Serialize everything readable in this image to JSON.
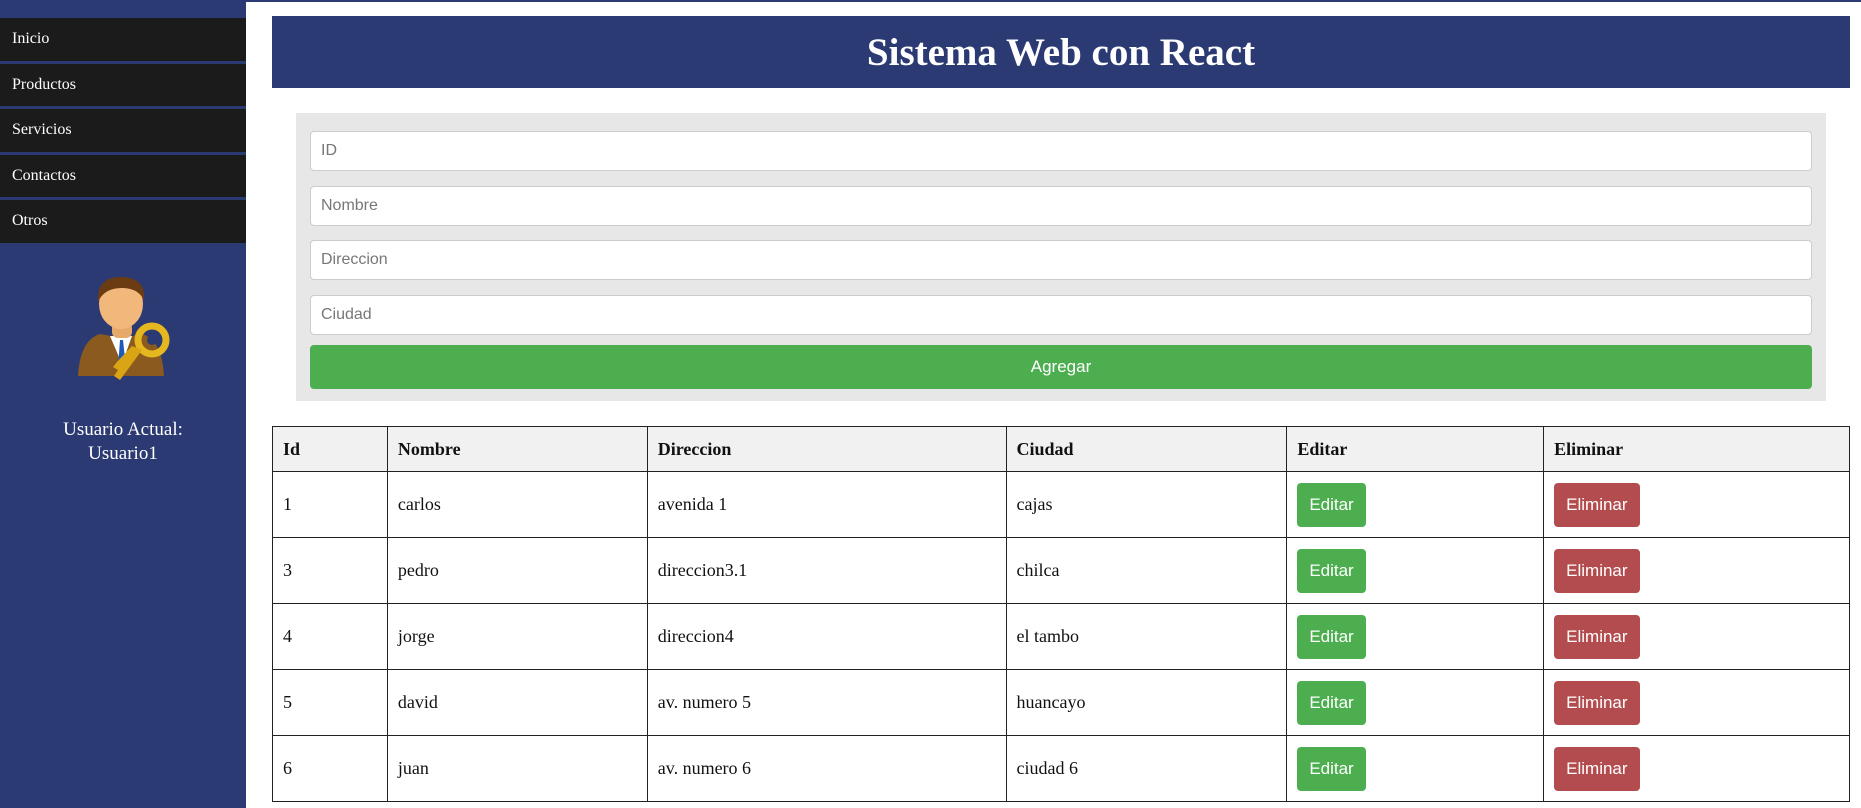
{
  "sidebar": {
    "items": [
      {
        "label": "Inicio"
      },
      {
        "label": "Productos"
      },
      {
        "label": "Servicios"
      },
      {
        "label": "Contactos"
      },
      {
        "label": "Otros"
      }
    ],
    "user_line1": "Usuario Actual:",
    "user_line2": "Usuario1",
    "avatar_icon": "user-key-icon"
  },
  "header": {
    "title": "Sistema Web con React"
  },
  "form": {
    "id_placeholder": "ID",
    "nombre_placeholder": "Nombre",
    "direccion_placeholder": "Direccion",
    "ciudad_placeholder": "Ciudad",
    "add_label": "Agregar"
  },
  "table": {
    "headers": [
      "Id",
      "Nombre",
      "Direccion",
      "Ciudad",
      "Editar",
      "Eliminar"
    ],
    "edit_label": "Editar",
    "delete_label": "Eliminar",
    "rows": [
      {
        "id": "1",
        "nombre": "carlos",
        "direccion": "avenida 1",
        "ciudad": "cajas"
      },
      {
        "id": "3",
        "nombre": "pedro",
        "direccion": "direccion3.1",
        "ciudad": "chilca"
      },
      {
        "id": "4",
        "nombre": "jorge",
        "direccion": "direccion4",
        "ciudad": "el tambo"
      },
      {
        "id": "5",
        "nombre": "david",
        "direccion": "av. numero 5",
        "ciudad": "huancayo"
      },
      {
        "id": "6",
        "nombre": "juan",
        "direccion": "av. numero 6",
        "ciudad": "ciudad 6"
      }
    ]
  },
  "colors": {
    "sidebar_bg": "#2b3a73",
    "nav_bg": "#1b1b1b",
    "success": "#4cae4f",
    "danger": "#b34c4e"
  }
}
